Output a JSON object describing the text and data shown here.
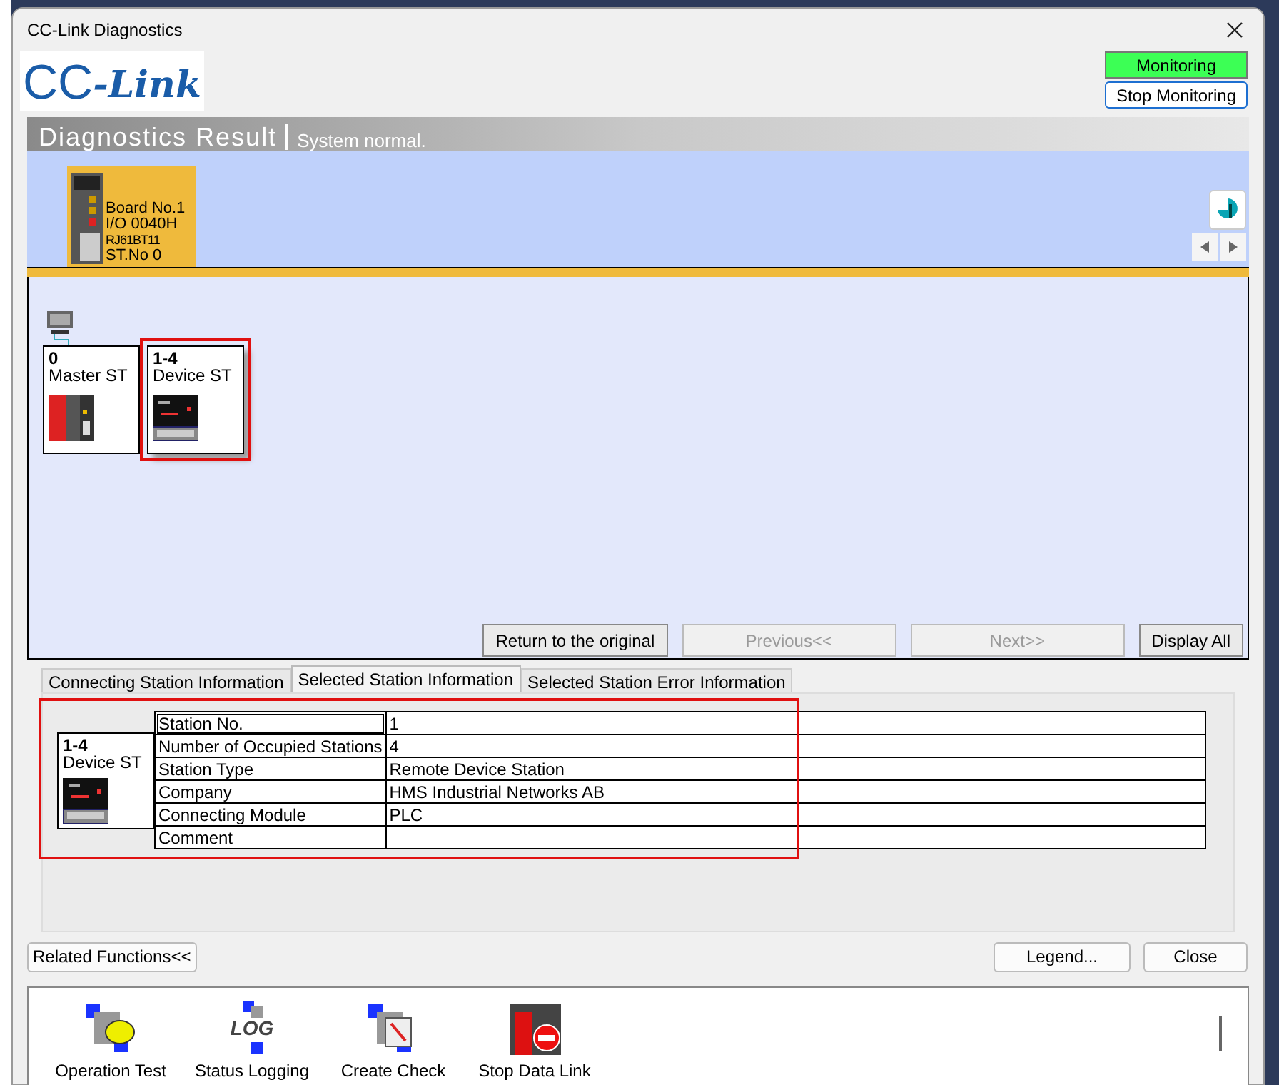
{
  "window": {
    "title": "CC-Link Diagnostics"
  },
  "logo": {
    "text_a": "CC",
    "text_b": "-Link"
  },
  "monitor": {
    "status": "Monitoring",
    "on": true,
    "button": "Stop Monitoring"
  },
  "header": {
    "title": "Diagnostics Result",
    "status": "System normal."
  },
  "board": {
    "lines": [
      "Board No.1",
      "I/O 0040H",
      "RJ61BT11",
      "ST.No 0"
    ],
    "selected": true
  },
  "stations": [
    {
      "number": "0",
      "label": "Master ST",
      "kind": "master",
      "selected": false
    },
    {
      "number": "1-4",
      "label": "Device ST",
      "kind": "device",
      "selected": true
    }
  ],
  "nav_buttons": [
    {
      "label": "Return to the original",
      "disabled": false
    },
    {
      "label": "Previous<<",
      "disabled": true
    },
    {
      "label": "Next>>",
      "disabled": true
    },
    {
      "label": "Display All",
      "disabled": false
    }
  ],
  "tabs": [
    {
      "label": "Connecting Station Information",
      "selected": false
    },
    {
      "label": "Selected Station Information",
      "selected": true
    },
    {
      "label": "Selected Station Error Information",
      "selected": false
    }
  ],
  "detail": {
    "number": "1-4",
    "label": "Device ST",
    "rows": [
      {
        "field": "Station No.",
        "value": "1"
      },
      {
        "field": "Number of Occupied Stations",
        "value": "4"
      },
      {
        "field": "Station Type",
        "value": "Remote Device Station"
      },
      {
        "field": "Company",
        "value": "HMS Industrial Networks AB"
      },
      {
        "field": "Connecting Module",
        "value": "PLC"
      },
      {
        "field": "Comment",
        "value": ""
      }
    ]
  },
  "footer_buttons": {
    "related": "Related Functions<<",
    "legend": "Legend...",
    "close": "Close"
  },
  "functions": [
    {
      "label": "Operation Test",
      "kind": "test"
    },
    {
      "label": "Status Logging",
      "kind": "log",
      "icon_text": "LOG"
    },
    {
      "label": "Create Check",
      "kind": "check"
    },
    {
      "label": "Stop Data Link",
      "kind": "stop"
    }
  ]
}
